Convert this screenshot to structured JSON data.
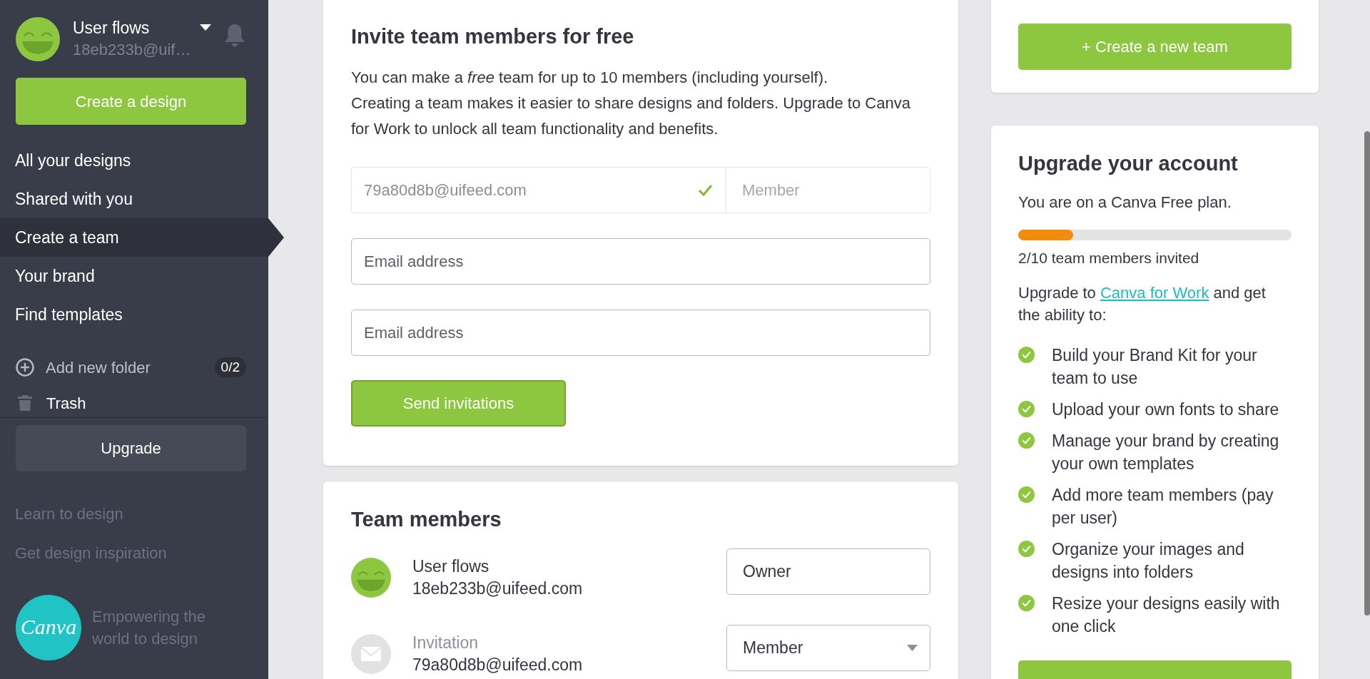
{
  "sidebar": {
    "profile": {
      "name": "User flows",
      "email": "18eb233b@uif…"
    },
    "create_button": "Create a design",
    "nav": [
      {
        "label": "All your designs",
        "selected": false
      },
      {
        "label": "Shared with you",
        "selected": false
      },
      {
        "label": "Create a team",
        "selected": true
      },
      {
        "label": "Your brand",
        "selected": false
      },
      {
        "label": "Find templates",
        "selected": false
      }
    ],
    "folders": [
      {
        "kind": "add",
        "label": "Add new folder",
        "count": "0/2"
      },
      {
        "kind": "trash",
        "label": "Trash"
      }
    ],
    "upgrade_button": "Upgrade",
    "links": [
      "Learn to design",
      "Get design inspiration"
    ],
    "logo": {
      "text": "Canva",
      "tagline": "Empowering the world to design"
    }
  },
  "invite_card": {
    "title": "Invite team members for free",
    "description": [
      "You can make a *free* team for up to 10 members (including yourself).",
      "Creating a team makes it easier to share designs and folders. Upgrade to Canva for Work to unlock all team functionality and benefits."
    ],
    "invited": [
      {
        "email": "79a80d8b@uifeed.com",
        "valid": true,
        "role": "Member",
        "disabled": true
      }
    ],
    "email_fields": [
      {
        "placeholder": "Email address"
      },
      {
        "placeholder": "Email address"
      }
    ],
    "send_button": "Send invitations"
  },
  "members_card": {
    "title": "Team members",
    "members": [
      {
        "kind": "user",
        "name": "User flows",
        "email": "18eb233b@uifeed.com",
        "role": "Owner",
        "dropdown": false
      },
      {
        "kind": "invitation",
        "name": "Invitation",
        "email": "79a80d8b@uifeed.com",
        "role": "Member",
        "dropdown": true
      }
    ]
  },
  "new_team_button": "+ Create a new team",
  "upgrade_card": {
    "title": "Upgrade your account",
    "plan": "You are on a Canva Free plan.",
    "progress": {
      "level": 0.2
    },
    "progress_label": "2/10 team members invited",
    "pitch": {
      "before": "Upgrade to",
      "link": "Canva for Work",
      "after": "and get the ability to:"
    },
    "features": [
      "Build your Brand Kit for your team to use",
      "Upload your own fonts to share",
      "Manage your brand by creating your own templates",
      "Add more team members (pay per user)",
      "Organize your images and designs into folders",
      "Resize your designs easily with one click"
    ]
  }
}
